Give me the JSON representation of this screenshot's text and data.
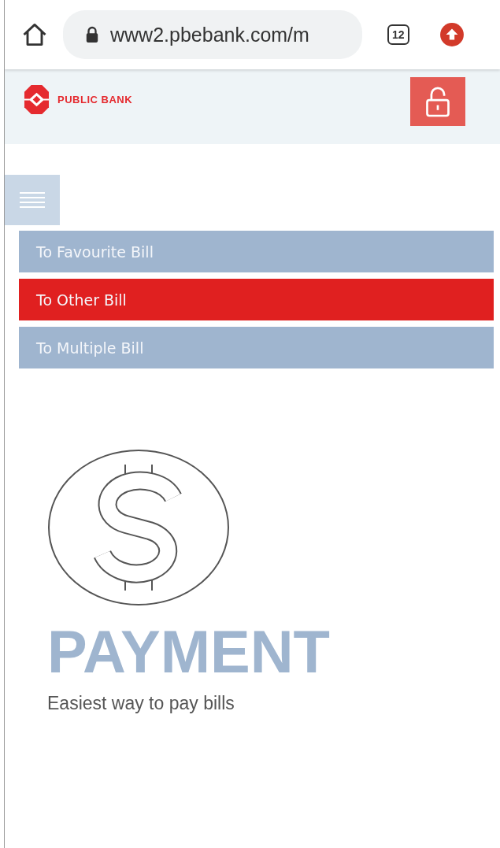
{
  "browser": {
    "url": "www2.pbebank.com/m",
    "tab_count": "12"
  },
  "header": {
    "brand": "PUBLIC BANK"
  },
  "menu_items": [
    {
      "label": "To Favourite Bill",
      "selected": false
    },
    {
      "label": "To Other Bill",
      "selected": true
    },
    {
      "label": "To Multiple Bill",
      "selected": false
    }
  ],
  "hero": {
    "title": "PAYMENT",
    "tagline": "Easiest way to pay bills"
  }
}
